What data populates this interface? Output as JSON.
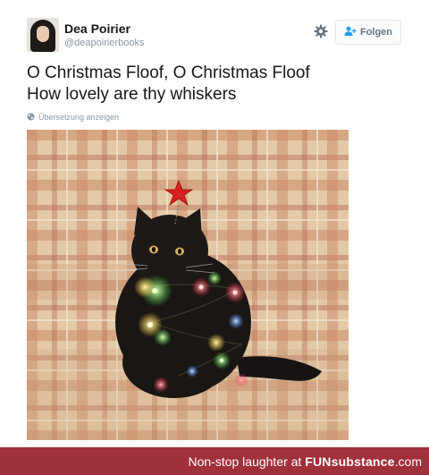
{
  "tweet": {
    "display_name": "Dea Poirier",
    "handle": "@deapoirierbooks",
    "follow_label": "Folgen",
    "text_lines": [
      "O Christmas Floof, O Christmas Floof",
      "How lovely are thy whiskers"
    ],
    "translate_label": "Übersetzung anzeigen"
  },
  "footer": {
    "caption": "Non-stop laughter at",
    "brand": "FUNsubstance",
    "domain": ".com"
  },
  "icons": {
    "settings": "gear-icon",
    "follow": "add-user-icon",
    "translate": "globe-icon"
  },
  "colors": {
    "footer_background": "#a0303a",
    "text_primary": "#14171a",
    "text_secondary": "#8899a6"
  }
}
